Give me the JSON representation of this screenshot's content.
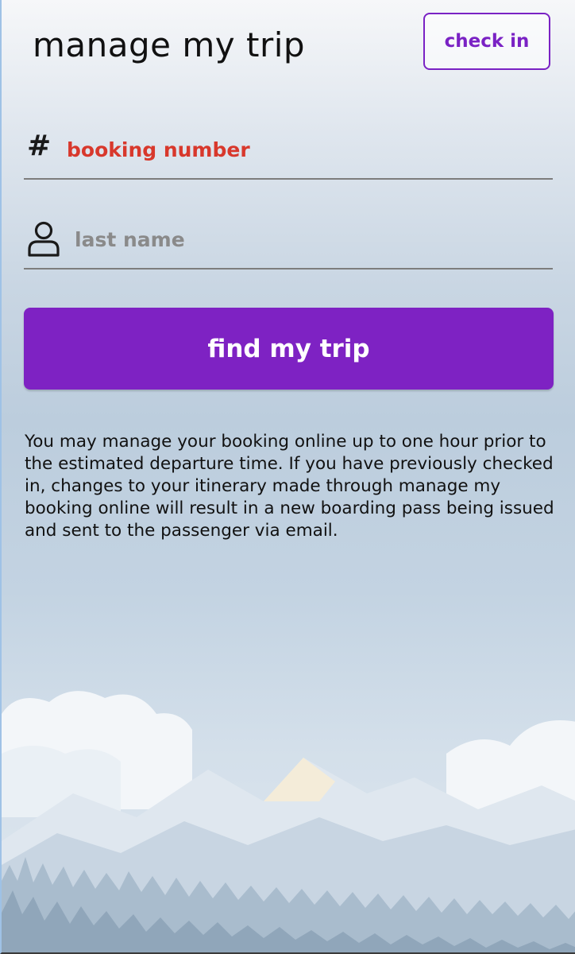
{
  "header": {
    "title": "manage my trip",
    "check_in_label": "check in"
  },
  "form": {
    "booking_number": {
      "icon": "hash-icon",
      "symbol": "#",
      "value": "",
      "placeholder": "booking number",
      "placeholder_color": "#d8382c"
    },
    "last_name": {
      "icon": "person-icon",
      "value": "",
      "placeholder": "last name"
    },
    "submit_label": "find my trip"
  },
  "info_text": "You may manage your booking online up to one hour prior to the estimated departure time. If you have previously checked in, changes to your itinerary made through manage my booking online will result in a new boarding pass being issued and sent to the passenger via email.",
  "colors": {
    "accent": "#7e22c3",
    "error": "#d8382c"
  }
}
